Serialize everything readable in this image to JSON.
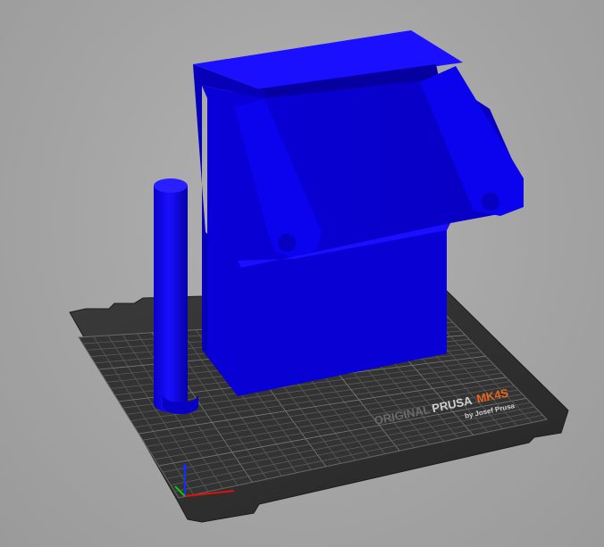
{
  "bed": {
    "brand_prefix": "ORIGINAL",
    "brand_name": "PRUSA",
    "model": "MK4S",
    "byline": "by Josef Prusa"
  },
  "colors": {
    "background": "#a6a6a6",
    "bed_plate": "#2b2b2b",
    "bed_grid": "#5a5a5a",
    "model_blue": "#0a00e6",
    "model_blue_dark": "#0600b0",
    "model_blue_light": "#1e14ff",
    "brand_accent": "#e8651a",
    "axis_x": "#e01010",
    "axis_y": "#10c010",
    "axis_z": "#1030ff"
  },
  "objects": [
    {
      "name": "box-model",
      "color": "#0a00e6"
    },
    {
      "name": "cylinder-model",
      "color": "#0a00e6"
    }
  ]
}
